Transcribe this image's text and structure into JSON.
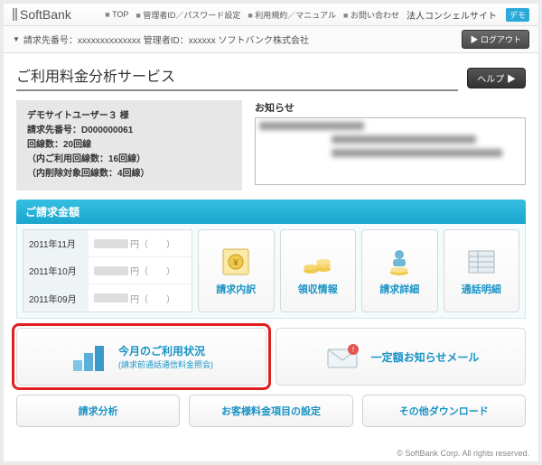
{
  "header": {
    "brand": "SoftBank",
    "nav": [
      "TOP",
      "管理者ID／パスワード設定",
      "利用規約／マニュアル",
      "お問い合わせ"
    ],
    "corp": "法人コンシェルサイト",
    "demo": "デモ"
  },
  "subbar": {
    "label": "請求先番号：xxxxxxxxxxxxxx 管理者ID：xxxxxx ソフトバンク株式会社",
    "logout": "ログアウト"
  },
  "title": "ご利用料金分析サービス",
  "help": "ヘルプ ▶",
  "user": {
    "l1": "デモサイトユーザー３ 様",
    "l2": "請求先番号：D000000061",
    "l3": "回線数：20回線",
    "l4": "（内ご利用回線数：16回線）",
    "l5": "（内削除対象回線数：4回線）"
  },
  "notice": {
    "title": "お知らせ"
  },
  "billSection": "ご請求金額",
  "bills": [
    {
      "m": "2011年11月",
      "suf": "円（　　）"
    },
    {
      "m": "2011年10月",
      "suf": "円（　　）"
    },
    {
      "m": "2011年09月",
      "suf": "円（　　）"
    }
  ],
  "cards": [
    "請求内訳",
    "領収情報",
    "請求詳細",
    "通話明細"
  ],
  "wide1": {
    "t": "今月のご利用状況",
    "s": "(請求前通話通信料金照会)"
  },
  "wide2": {
    "t": "一定額お知らせメール"
  },
  "btns": [
    "請求分析",
    "お客様料金項目の設定",
    "その他ダウンロード"
  ],
  "footer": "© SoftBank Corp. All rights reserved."
}
